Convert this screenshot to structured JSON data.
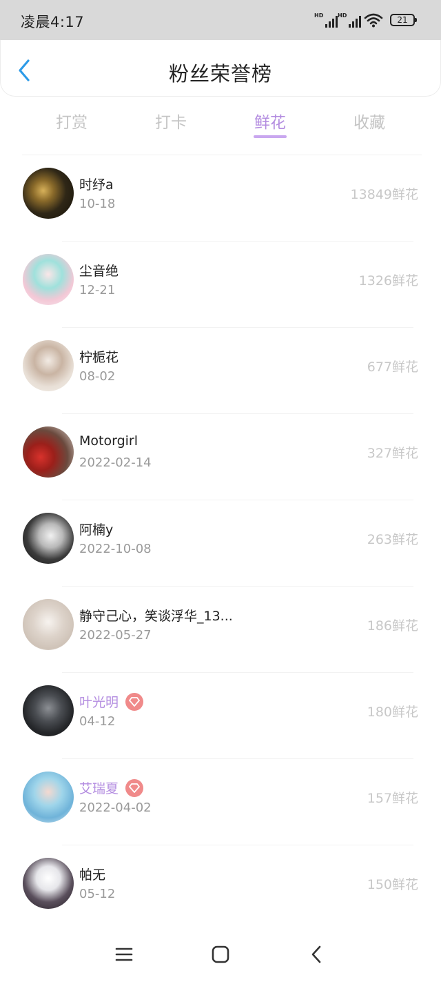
{
  "status_bar": {
    "time": "凌晨4:17",
    "signal1_label": "HD",
    "signal2_label": "HD",
    "battery": "21"
  },
  "header": {
    "title": "粉丝荣誉榜",
    "back_icon": "chevron-left-icon"
  },
  "tabs": [
    {
      "label": "打赏",
      "active": false
    },
    {
      "label": "打卡",
      "active": false
    },
    {
      "label": "鲜花",
      "active": true
    },
    {
      "label": "收藏",
      "active": false
    }
  ],
  "fans": [
    {
      "name": "时纾a",
      "date": "10-18",
      "count": "13849鲜花",
      "vip": false
    },
    {
      "name": "尘音绝",
      "date": "12-21",
      "count": "1326鲜花",
      "vip": false
    },
    {
      "name": "柠栀花",
      "date": "08-02",
      "count": "677鲜花",
      "vip": false
    },
    {
      "name": "Motorgirl",
      "date": "2022-02-14",
      "count": "327鲜花",
      "vip": false
    },
    {
      "name": "阿楠y",
      "date": "2022-10-08",
      "count": "263鲜花",
      "vip": false
    },
    {
      "name": "静守己心，笑谈浮华_13...",
      "date": "2022-05-27",
      "count": "186鲜花",
      "vip": false
    },
    {
      "name": "叶光明",
      "date": "04-12",
      "count": "180鲜花",
      "vip": true
    },
    {
      "name": "艾瑞夏",
      "date": "2022-04-02",
      "count": "157鲜花",
      "vip": true
    },
    {
      "name": "帕无",
      "date": "05-12",
      "count": "150鲜花",
      "vip": false
    }
  ],
  "colors": {
    "accent": "#b38ce0",
    "tab_underline": "#c9a7ef",
    "vip_badge": "#f08a8a",
    "back_arrow": "#2d9be8",
    "status_bar": "#d9d9d9"
  },
  "nav_bar": {
    "menu_icon": "menu-icon",
    "home_icon": "home-square-icon",
    "back_icon": "back-chevron-icon"
  }
}
